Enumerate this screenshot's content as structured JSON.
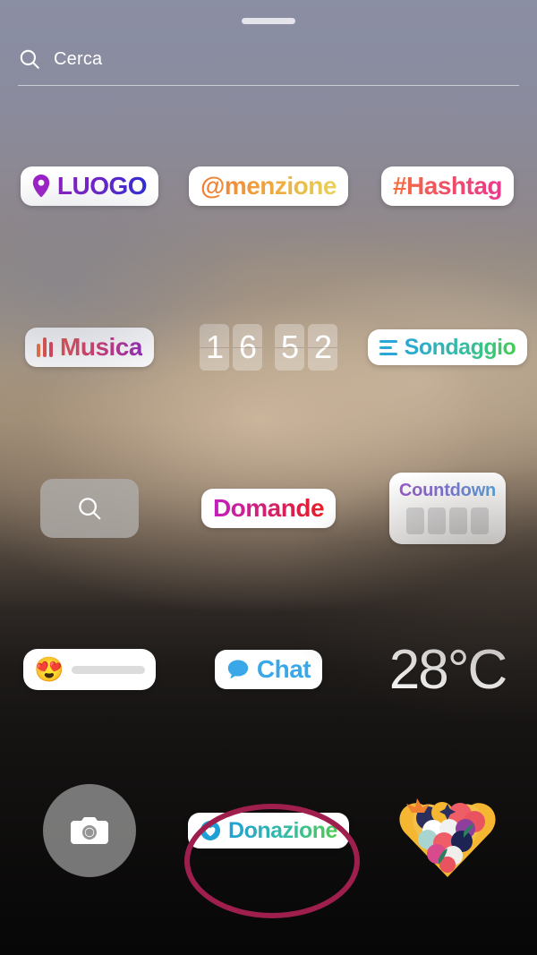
{
  "app": {
    "name": "Instagram Stories sticker tray",
    "language": "it"
  },
  "header": {
    "drag_handle": "drag-handle",
    "search": {
      "icon": "search-icon",
      "placeholder": "Cerca",
      "value": "Cerca"
    }
  },
  "colors": {
    "annotation_ellipse": "#9e1f4d",
    "sticker_background": "#ffffff",
    "chat_blue": "#3aa8e8",
    "location_pin": "#9b1fc7",
    "gif_tile_gray": "#afaca8",
    "camera_circle_gray": "#969696",
    "countdown_block_gray": "#dcdcdd",
    "slider_track_gray": "#dcdcdd"
  },
  "grid": {
    "rows": [
      {
        "cells": [
          {
            "name": "location",
            "type": "pill",
            "label": "LUOGO",
            "icon": "location-pin-icon"
          },
          {
            "name": "mention",
            "type": "pill",
            "label": "@menzione",
            "icon": null
          },
          {
            "name": "hashtag",
            "type": "pill",
            "label": "#Hashtag",
            "icon": null
          }
        ]
      },
      {
        "cells": [
          {
            "name": "music",
            "type": "pill",
            "label": "Musica",
            "icon": "music-bars-icon"
          },
          {
            "name": "clock",
            "type": "clock",
            "label": "1652",
            "digits": [
              "1",
              "6",
              "5",
              "2"
            ]
          },
          {
            "name": "poll",
            "type": "pill",
            "label": "Sondaggio",
            "icon": "poll-lines-icon"
          }
        ]
      },
      {
        "cells": [
          {
            "name": "gif-search",
            "type": "tile",
            "label": "",
            "icon": "search-icon"
          },
          {
            "name": "questions",
            "type": "pill",
            "label": "Domande",
            "icon": null
          },
          {
            "name": "countdown",
            "type": "card",
            "label": "Countdown",
            "blocks": 4
          }
        ]
      },
      {
        "cells": [
          {
            "name": "emoji-slider",
            "type": "slider",
            "label": "",
            "emoji": "😍"
          },
          {
            "name": "chat",
            "type": "pill",
            "label": "Chat",
            "icon": "speech-bubble-icon"
          },
          {
            "name": "weather",
            "type": "text",
            "label": "28°C"
          }
        ]
      },
      {
        "cells": [
          {
            "name": "camera",
            "type": "circle",
            "label": "",
            "icon": "camera-icon"
          },
          {
            "name": "donation",
            "type": "pill",
            "label": "Donazione",
            "icon": "heart-circle-icon",
            "annotated": true
          },
          {
            "name": "support-illustration",
            "type": "illustration",
            "label": "hands-holding-heart"
          }
        ]
      }
    ]
  }
}
